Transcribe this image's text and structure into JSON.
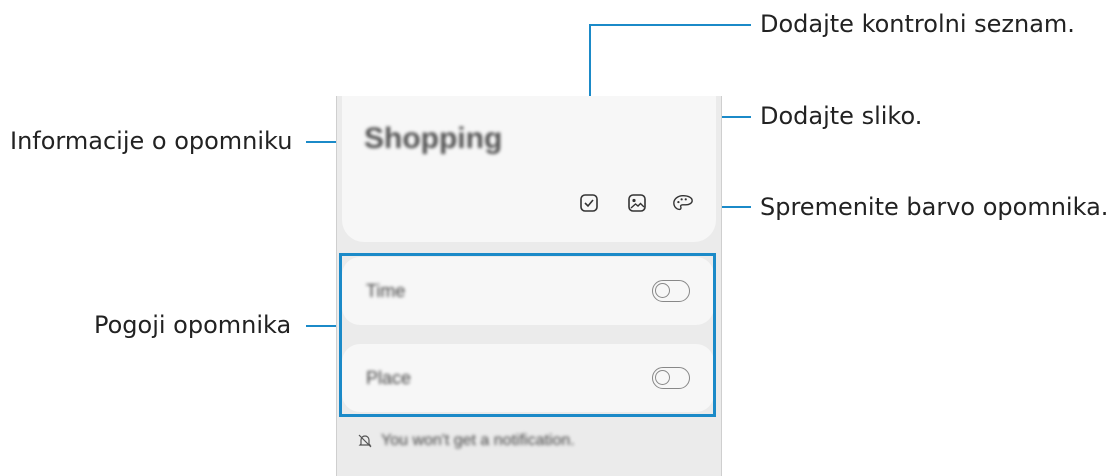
{
  "callouts": {
    "checklist": "Dodajte kontrolni seznam.",
    "image": "Dodajte sliko.",
    "color": "Spremenite barvo opomnika.",
    "info": "Informacije o opomniku",
    "conditions": "Pogoji opomnika"
  },
  "reminder": {
    "title": "Shopping",
    "conditions": [
      {
        "label": "Time",
        "enabled": false
      },
      {
        "label": "Place",
        "enabled": false
      }
    ],
    "notification_text": "You won't get a notification."
  },
  "icons": {
    "checklist": "checkbox-icon",
    "image": "image-icon",
    "color": "palette-icon",
    "notification": "bell-off-icon"
  },
  "colors": {
    "accent": "#1b8ac8",
    "card": "#f7f7f7",
    "screen_bg": "#ebebeb"
  }
}
